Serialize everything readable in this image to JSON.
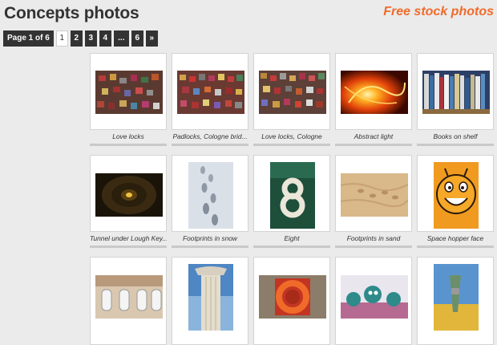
{
  "header": {
    "title": "Concepts photos",
    "brand": "Free stock photos"
  },
  "pagination": {
    "info": "Page 1 of 6",
    "pages": [
      "1",
      "2",
      "3",
      "4",
      "...",
      "6",
      "»"
    ],
    "current": "1"
  },
  "photos": [
    {
      "caption": "Love locks",
      "thumb": "locks-1"
    },
    {
      "caption": "Padlocks, Cologne brid...",
      "thumb": "locks-2"
    },
    {
      "caption": "Love locks, Cologne",
      "thumb": "locks-3"
    },
    {
      "caption": "Abstract light",
      "thumb": "light"
    },
    {
      "caption": "Books on shelf",
      "thumb": "books"
    },
    {
      "caption": "Tunnel under Lough Key...",
      "thumb": "tunnel"
    },
    {
      "caption": "Footprints in snow",
      "thumb": "snow"
    },
    {
      "caption": "Eight",
      "thumb": "eight"
    },
    {
      "caption": "Footprints in sand",
      "thumb": "sand"
    },
    {
      "caption": "Space hopper face",
      "thumb": "hopper"
    },
    {
      "caption": "",
      "thumb": "urinals"
    },
    {
      "caption": "",
      "thumb": "column"
    },
    {
      "caption": "",
      "thumb": "lifebuoy"
    },
    {
      "caption": "",
      "thumb": "toys"
    },
    {
      "caption": "",
      "thumb": "peg"
    }
  ]
}
